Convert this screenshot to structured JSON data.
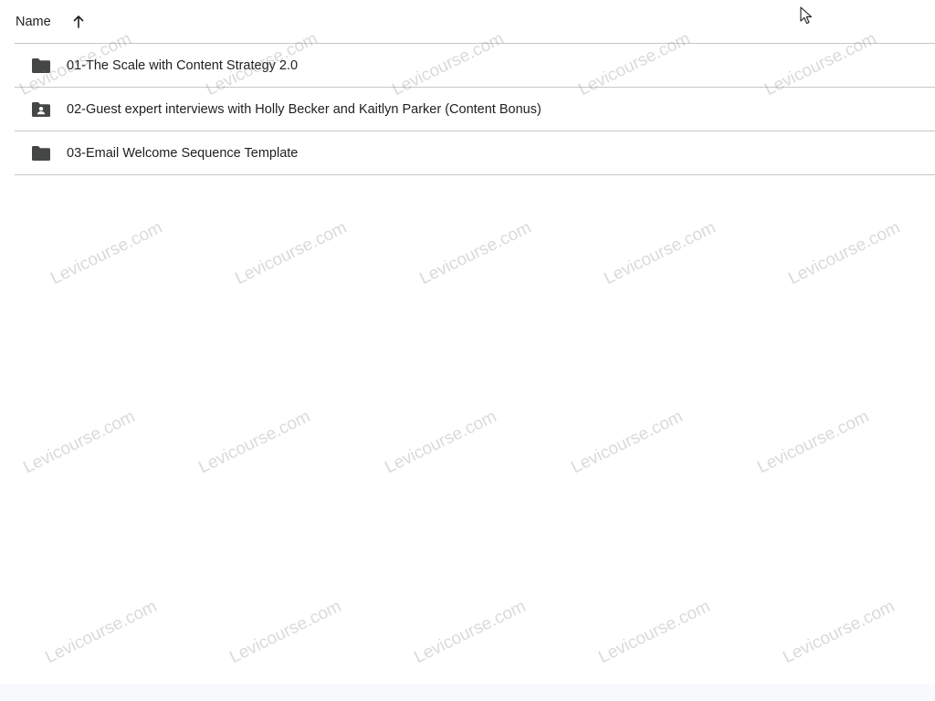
{
  "header": {
    "name_label": "Name",
    "sort_direction": "ascending",
    "sort_icon": "arrow-up-icon"
  },
  "files": [
    {
      "name": "01-The Scale with Content Strategy 2.0",
      "icon": "folder-icon"
    },
    {
      "name": "02-Guest expert interviews with Holly Becker and Kaitlyn Parker (Content Bonus)",
      "icon": "shared-folder-icon"
    },
    {
      "name": "03-Email Welcome Sequence Template",
      "icon": "folder-icon"
    }
  ],
  "watermark": {
    "text": "Levicourse.com"
  },
  "colors": {
    "folder": "#444746",
    "divider": "#c7c7c7",
    "text": "#1f1f1f"
  }
}
